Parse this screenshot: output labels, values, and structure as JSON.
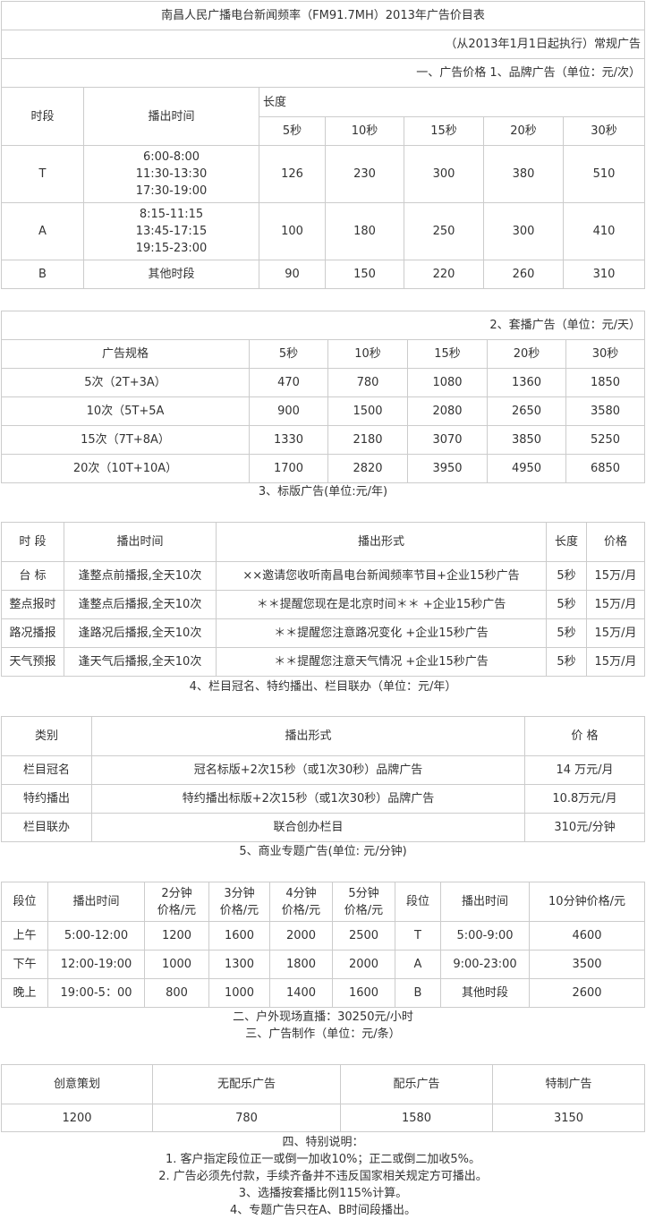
{
  "t1": {
    "title": "南昌人民广播电台新闻频率（FM91.7MH）2013年广告价目表",
    "effective": "（从2013年1月1日起执行）常规广告",
    "section": "一、广告价格 1、品牌广告（单位：元/次）",
    "h_period": "时段",
    "h_time": "播出时间",
    "h_length": "长度",
    "lengths": [
      "5秒",
      "10秒",
      "15秒",
      "20秒",
      "30秒"
    ],
    "rows": [
      {
        "period": "T",
        "times": [
          "6:00-8:00",
          "11:30-13:30",
          "17:30-19:00"
        ],
        "prices": [
          "126",
          "230",
          "300",
          "380",
          "510"
        ]
      },
      {
        "period": "A",
        "times": [
          "8:15-11:15",
          "13:45-17:15",
          "19:15-23:00"
        ],
        "prices": [
          "100",
          "180",
          "250",
          "300",
          "410"
        ]
      },
      {
        "period": "B",
        "times": [
          "其他时段"
        ],
        "prices": [
          "90",
          "150",
          "220",
          "260",
          "310"
        ]
      }
    ]
  },
  "t2": {
    "section": "2、套播广告（单位：元/天）",
    "h_spec": "广告规格",
    "lengths": [
      "5秒",
      "10秒",
      "15秒",
      "20秒",
      "30秒"
    ],
    "rows": [
      {
        "spec": "5次（2T+3A）",
        "prices": [
          "470",
          "780",
          "1080",
          "1360",
          "1850"
        ]
      },
      {
        "spec": "10次（5T+5A",
        "prices": [
          "900",
          "1500",
          "2080",
          "2650",
          "3580"
        ]
      },
      {
        "spec": "15次（7T+8A）",
        "prices": [
          "1330",
          "2180",
          "3070",
          "3850",
          "5250"
        ]
      },
      {
        "spec": "20次（10T+10A）",
        "prices": [
          "1700",
          "2820",
          "3950",
          "4950",
          "6850"
        ]
      }
    ]
  },
  "t3": {
    "caption": "3、标版广告(单位:元/年)",
    "headers": [
      "时 段",
      "播出时间",
      "播出形式",
      "长度",
      "价格"
    ],
    "rows": [
      [
        "台 标",
        "逢整点前播报,全天10次",
        "××邀请您收听南昌电台新闻频率节目+企业15秒广告",
        "5秒",
        "15万/月"
      ],
      [
        "整点报时",
        "逢整点后播报,全天10次",
        "＊＊提醒您现在是北京时间＊＊ +企业15秒广告",
        "5秒",
        "15万/月"
      ],
      [
        "路况播报",
        "逢路况后播报,全天10次",
        "＊＊提醒您注意路况变化 +企业15秒广告",
        "5秒",
        "15万/月"
      ],
      [
        "天气预报",
        "逢天气后播报,全天10次",
        "＊＊提醒您注意天气情况 +企业15秒广告",
        "5秒",
        "15万/月"
      ]
    ]
  },
  "t4": {
    "caption": "4、栏目冠名、特约播出、栏目联办（单位：元/年）",
    "headers": [
      "类别",
      "播出形式",
      "价 格"
    ],
    "rows": [
      [
        "栏目冠名",
        "冠名标版+2次15秒（或1次30秒）品牌广告",
        "14 万元/月"
      ],
      [
        "特约播出",
        "特约播出标版+2次15秒（或1次30秒）品牌广告",
        "10.8万元/月"
      ],
      [
        "栏目联办",
        "联合创办栏目",
        "310元/分钟"
      ]
    ]
  },
  "t5": {
    "caption": "5、商业专题广告(单位: 元/分钟)",
    "headers": [
      "段位",
      "播出时间",
      [
        "2分钟",
        "价格/元"
      ],
      [
        "3分钟",
        "价格/元"
      ],
      [
        "4分钟",
        "价格/元"
      ],
      [
        "5分钟",
        "价格/元"
      ],
      "段位",
      "播出时间",
      "10分钟价格/元"
    ],
    "rows": [
      [
        "上午",
        "5:00-12:00",
        "1200",
        "1600",
        "2000",
        "2500",
        "T",
        "5:00-9:00",
        "4600"
      ],
      [
        "下午",
        "12:00-19:00",
        "1000",
        "1300",
        "1800",
        "2000",
        "A",
        "9:00-23:00",
        "3500"
      ],
      [
        "晚上",
        "19:00-5：00",
        "800",
        "1000",
        "1400",
        "1600",
        "B",
        "其他时段",
        "2600"
      ]
    ]
  },
  "mid": {
    "live": "二、户外现场直播：30250元/小时",
    "production": "三、广告制作（单位：元/条）"
  },
  "t6": {
    "headers": [
      "创意策划",
      "无配乐广告",
      "配乐广告",
      "特制广告"
    ],
    "values": [
      "1200",
      "780",
      "1580",
      "3150"
    ]
  },
  "notes": {
    "title": "四、特别说明：",
    "items": [
      "1. 客户指定段位正一或倒一加收10%；正二或倒二加收5%。",
      "2. 广告必须先付款，手续齐备并不违反国家相关规定方可播出。",
      "3、选播按套播比例115%计算。",
      "4、专题广告只在A、B时间段播出。"
    ]
  }
}
